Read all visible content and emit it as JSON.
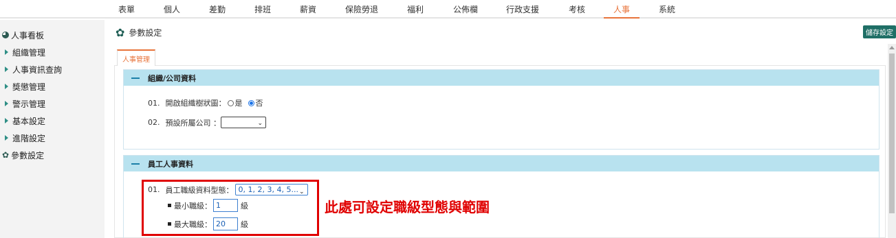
{
  "topnav": {
    "tabs": [
      "表單",
      "個人",
      "差勤",
      "排班",
      "薪資",
      "保險勞退",
      "福利",
      "公佈欄",
      "行政支援",
      "考核",
      "人事",
      "系統"
    ],
    "active": "人事"
  },
  "sidebar": {
    "items": [
      {
        "label": "人事看板",
        "icon": "pie-chart-icon"
      },
      {
        "label": "組織管理",
        "icon": "triangle-right-icon"
      },
      {
        "label": "人事資訊查詢",
        "icon": "triangle-right-icon"
      },
      {
        "label": "獎懲管理",
        "icon": "triangle-right-icon"
      },
      {
        "label": "警示管理",
        "icon": "triangle-right-icon"
      },
      {
        "label": "基本設定",
        "icon": "triangle-right-icon"
      },
      {
        "label": "進階設定",
        "icon": "triangle-right-icon"
      },
      {
        "label": "參數設定",
        "icon": "gear-icon"
      }
    ]
  },
  "header": {
    "title": "參數設定",
    "save_label": "儲存設定"
  },
  "content_tab": "人事管理",
  "section1": {
    "title": "組織/公司資料",
    "row1": {
      "num": "01.",
      "label": "開啟組織樹狀圖：",
      "opt_yes": "是",
      "opt_no": "否",
      "selected": "否"
    },
    "row2": {
      "num": "02.",
      "label": "預設所屬公司 ：",
      "value": ""
    }
  },
  "section2": {
    "title": "員工人事資料",
    "row1": {
      "num": "01.",
      "label": "員工職級資料型態：",
      "value": "0, 1, 2, 3, 4, 5..."
    },
    "min": {
      "label": "最小職級：",
      "value": "1",
      "unit": "級"
    },
    "max": {
      "label": "最大職級：",
      "value": "20",
      "unit": "級"
    }
  },
  "annotation": "此處可設定職級型態與範圍",
  "colors": {
    "accent": "#e8733a",
    "primary": "#1f6f66",
    "section_header": "#b8e2ef",
    "annotation": "#e00000"
  }
}
